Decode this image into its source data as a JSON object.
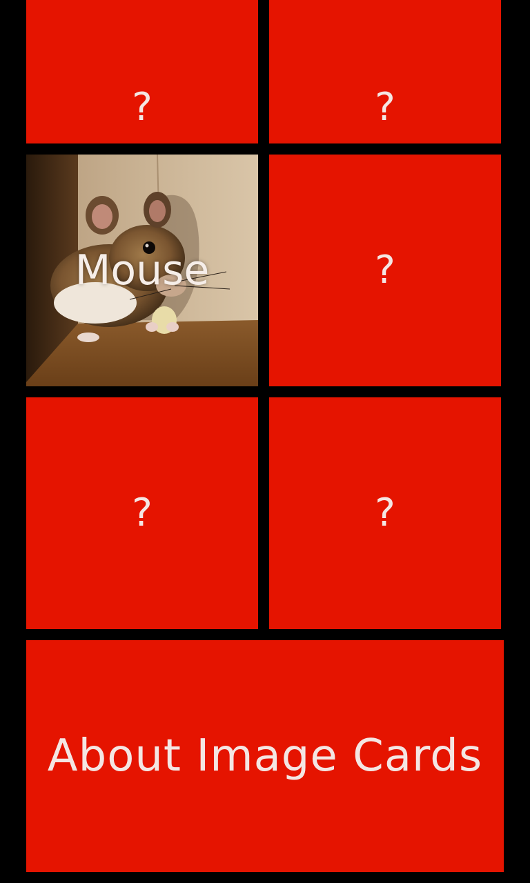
{
  "tiles": [
    {
      "label": "?"
    },
    {
      "label": "?"
    },
    {
      "label": "Mouse"
    },
    {
      "label": "?"
    },
    {
      "label": "?"
    },
    {
      "label": "?"
    }
  ],
  "about": {
    "label": "About Image Cards"
  },
  "colors": {
    "tile_red": "#E51400",
    "background": "#000000",
    "text": "#F4E6E3"
  }
}
